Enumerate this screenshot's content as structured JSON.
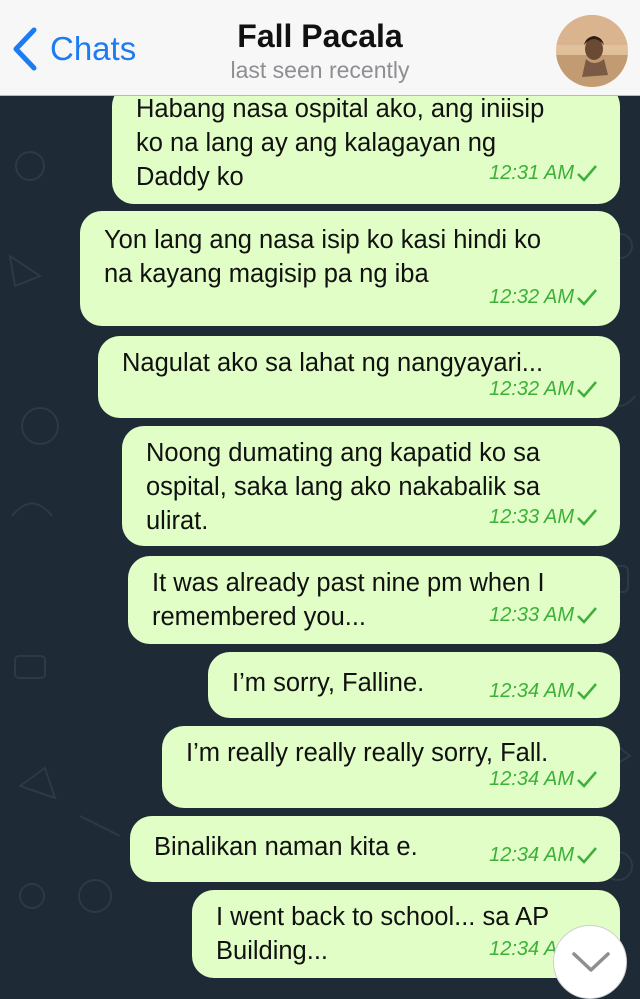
{
  "header": {
    "back_label": "Chats",
    "contact_name": "Fall Pacala",
    "status": "last seen recently"
  },
  "messages": [
    {
      "text": "Habang nasa ospital ako, ang iniisip\nko na lang ay ang kalagayan ng\nDaddy ko",
      "time": "12:31 AM"
    },
    {
      "text": "Yon lang ang nasa isip ko kasi hindi ko\nna kayang magisip pa ng iba",
      "time": "12:32 AM"
    },
    {
      "text": "Nagulat ako sa lahat ng nangyayari...",
      "time": "12:32 AM"
    },
    {
      "text": "Noong dumating ang kapatid ko sa\nospital, saka lang ako nakabalik sa\nulirat.",
      "time": "12:33 AM"
    },
    {
      "text": "It was already past nine pm when I\nremembered you...",
      "time": "12:33 AM"
    },
    {
      "text": "I’m sorry, Falline.",
      "time": "12:34 AM"
    },
    {
      "text": "I’m really really really sorry, Fall.",
      "time": "12:34 AM"
    },
    {
      "text": "Binalikan naman kita e.",
      "time": "12:34 AM"
    },
    {
      "text": "I went back to school... sa AP\nBuilding...",
      "time": "12:34 AM"
    }
  ],
  "colors": {
    "outgoing_bubble": "#e1fec6",
    "timestamp": "#3db03a",
    "accent": "#1d7cf2",
    "chat_background": "#1e2a36"
  },
  "icons": [
    "chevron-left-icon",
    "checkmark-icon",
    "chevron-down-icon"
  ]
}
